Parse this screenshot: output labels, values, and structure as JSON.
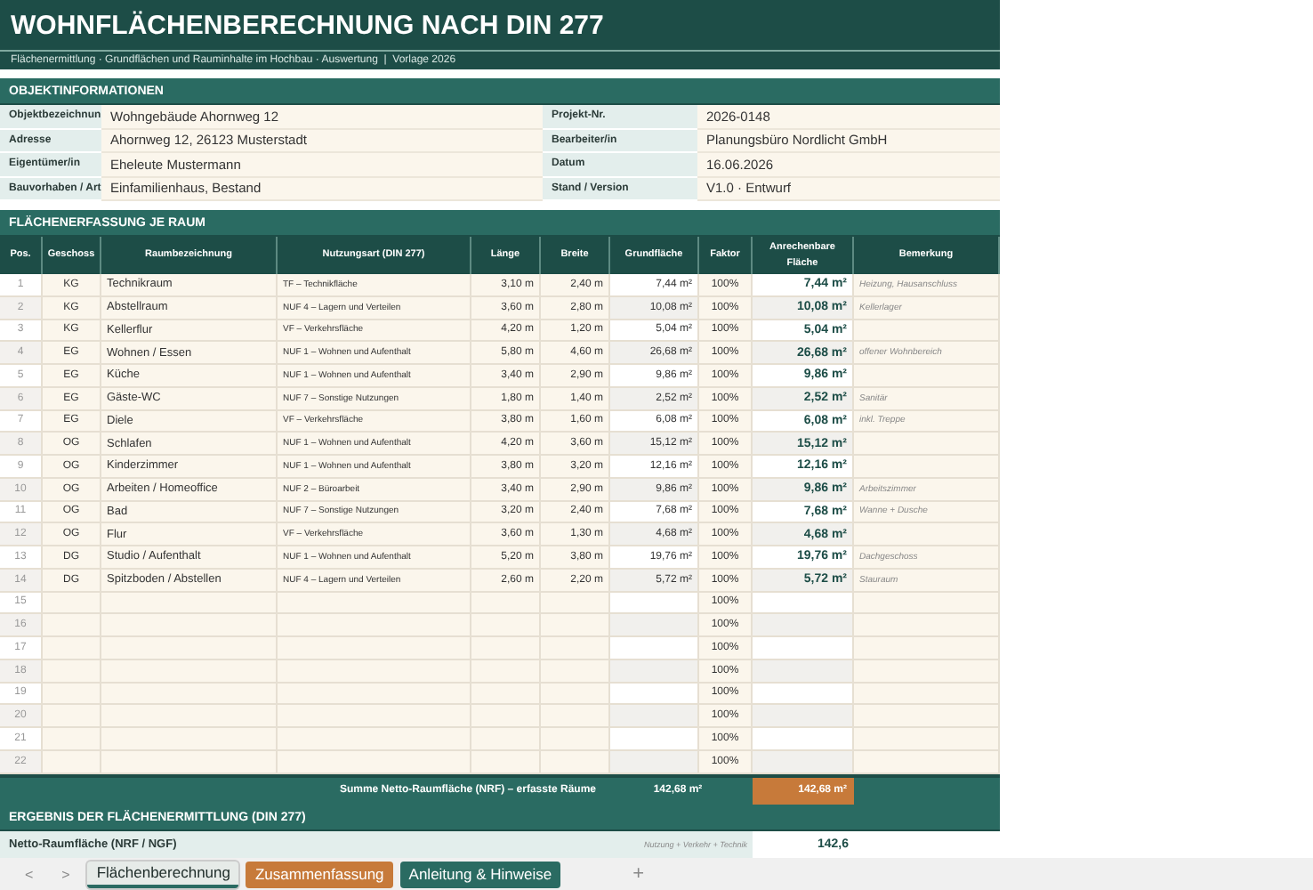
{
  "title": "WOHNFLÄCHENBERECHNUNG NACH DIN 277",
  "subtitle": "Flächenermittlung · Grundflächen und Rauminhalte im Hochbau · Auswertung  |  Vorlage 2026",
  "object_info": {
    "heading": "OBJEKTINFORMATIONEN",
    "rows": [
      {
        "label": "Objektbezeichnun",
        "value": "Wohngebäude Ahornweg 12",
        "label_2": "Projekt-Nr.",
        "value_2": "2026-0148"
      },
      {
        "label": "Adresse",
        "value": "Ahornweg 12, 26123 Musterstadt",
        "label_2": "Bearbeiter/in",
        "value_2": "Planungsbüro Nordlicht GmbH"
      },
      {
        "label": "Eigentümer/in",
        "value": "Eheleute Mustermann",
        "label_2": "Datum",
        "value_2": "16.06.2026"
      },
      {
        "label": "Bauvorhaben / Art",
        "value": "Einfamilienhaus, Bestand",
        "label_2": "Stand / Version",
        "value_2": "V1.0 · Entwurf"
      }
    ]
  },
  "rooms": {
    "heading": "FLÄCHENERFASSUNG JE RAUM",
    "columns": [
      "Pos.",
      "Geschoss",
      "Raumbezeichnung",
      "Nutzungsart (DIN 277)",
      "Länge",
      "Breite",
      "Grundfläche",
      "Faktor",
      "Anrechenbare Fläche",
      "Bemerkung"
    ],
    "rows": [
      [
        "1",
        "KG",
        "Technikraum",
        "TF – Technikfläche",
        "3,10 m",
        "2,40 m",
        "7,44 m²",
        "100%",
        "7,44 m²",
        "Heizung, Hausanschluss"
      ],
      [
        "2",
        "KG",
        "Abstellraum",
        "NUF 4 – Lagern und Verteilen",
        "3,60 m",
        "2,80 m",
        "10,08 m²",
        "100%",
        "10,08 m²",
        "Kellerlager"
      ],
      [
        "3",
        "KG",
        "Kellerflur",
        "VF – Verkehrsfläche",
        "4,20 m",
        "1,20 m",
        "5,04 m²",
        "100%",
        "5,04 m²",
        ""
      ],
      [
        "4",
        "EG",
        "Wohnen / Essen",
        "NUF 1 – Wohnen und Aufenthalt",
        "5,80 m",
        "4,60 m",
        "26,68 m²",
        "100%",
        "26,68 m²",
        "offener Wohnbereich"
      ],
      [
        "5",
        "EG",
        "Küche",
        "NUF 1 – Wohnen und Aufenthalt",
        "3,40 m",
        "2,90 m",
        "9,86 m²",
        "100%",
        "9,86 m²",
        ""
      ],
      [
        "6",
        "EG",
        "Gäste-WC",
        "NUF 7 – Sonstige Nutzungen",
        "1,80 m",
        "1,40 m",
        "2,52 m²",
        "100%",
        "2,52 m²",
        "Sanitär"
      ],
      [
        "7",
        "EG",
        "Diele",
        "VF – Verkehrsfläche",
        "3,80 m",
        "1,60 m",
        "6,08 m²",
        "100%",
        "6,08 m²",
        "inkl. Treppe"
      ],
      [
        "8",
        "OG",
        "Schlafen",
        "NUF 1 – Wohnen und Aufenthalt",
        "4,20 m",
        "3,60 m",
        "15,12 m²",
        "100%",
        "15,12 m²",
        ""
      ],
      [
        "9",
        "OG",
        "Kinderzimmer",
        "NUF 1 – Wohnen und Aufenthalt",
        "3,80 m",
        "3,20 m",
        "12,16 m²",
        "100%",
        "12,16 m²",
        ""
      ],
      [
        "10",
        "OG",
        "Arbeiten / Homeoffice",
        "NUF 2 – Büroarbeit",
        "3,40 m",
        "2,90 m",
        "9,86 m²",
        "100%",
        "9,86 m²",
        "Arbeitszimmer"
      ],
      [
        "11",
        "OG",
        "Bad",
        "NUF 7 – Sonstige Nutzungen",
        "3,20 m",
        "2,40 m",
        "7,68 m²",
        "100%",
        "7,68 m²",
        "Wanne + Dusche"
      ],
      [
        "12",
        "OG",
        "Flur",
        "VF – Verkehrsfläche",
        "3,60 m",
        "1,30 m",
        "4,68 m²",
        "100%",
        "4,68 m²",
        ""
      ],
      [
        "13",
        "DG",
        "Studio / Aufenthalt",
        "NUF 1 – Wohnen und Aufenthalt",
        "5,20 m",
        "3,80 m",
        "19,76 m²",
        "100%",
        "19,76 m²",
        "Dachgeschoss"
      ],
      [
        "14",
        "DG",
        "Spitzboden / Abstellen",
        "NUF 4 – Lagern und Verteilen",
        "2,60 m",
        "2,20 m",
        "5,72 m²",
        "100%",
        "5,72 m²",
        "Stauraum"
      ],
      [
        "15",
        "",
        "",
        "",
        "",
        "",
        "",
        "100%",
        "",
        ""
      ],
      [
        "16",
        "",
        "",
        "",
        "",
        "",
        "",
        "100%",
        "",
        ""
      ],
      [
        "17",
        "",
        "",
        "",
        "",
        "",
        "",
        "100%",
        "",
        ""
      ],
      [
        "18",
        "",
        "",
        "",
        "",
        "",
        "",
        "100%",
        "",
        ""
      ],
      [
        "19",
        "",
        "",
        "",
        "",
        "",
        "",
        "100%",
        "",
        ""
      ],
      [
        "20",
        "",
        "",
        "",
        "",
        "",
        "",
        "100%",
        "",
        ""
      ],
      [
        "21",
        "",
        "",
        "",
        "",
        "",
        "",
        "100%",
        "",
        ""
      ],
      [
        "22",
        "",
        "",
        "",
        "",
        "",
        "",
        "100%",
        "",
        ""
      ]
    ],
    "total": {
      "label": "Summe Netto-Raumfläche (NRF) – erfasste Räume",
      "area": "142,68 m²",
      "net": "142,68 m²"
    }
  },
  "result": {
    "heading": "ERGEBNIS DER FLÄCHENERMITTLUNG (DIN 277)",
    "label": "Netto-Raumfläche (NRF / NGF)",
    "hint": "Nutzung + Verkehr + Technik",
    "value": "142,6"
  },
  "sheet_tabs": [
    {
      "label": "Flächenberechnung",
      "selected": true,
      "color": "#e6ebe8"
    },
    {
      "label": "Zusammenfassung",
      "selected": false,
      "color": "#c77a3a"
    },
    {
      "label": "Anleitung & Hinweise",
      "selected": false,
      "color": "#2a6b62"
    }
  ],
  "nav": {
    "prev": "<",
    "next": ">",
    "add": "+"
  }
}
